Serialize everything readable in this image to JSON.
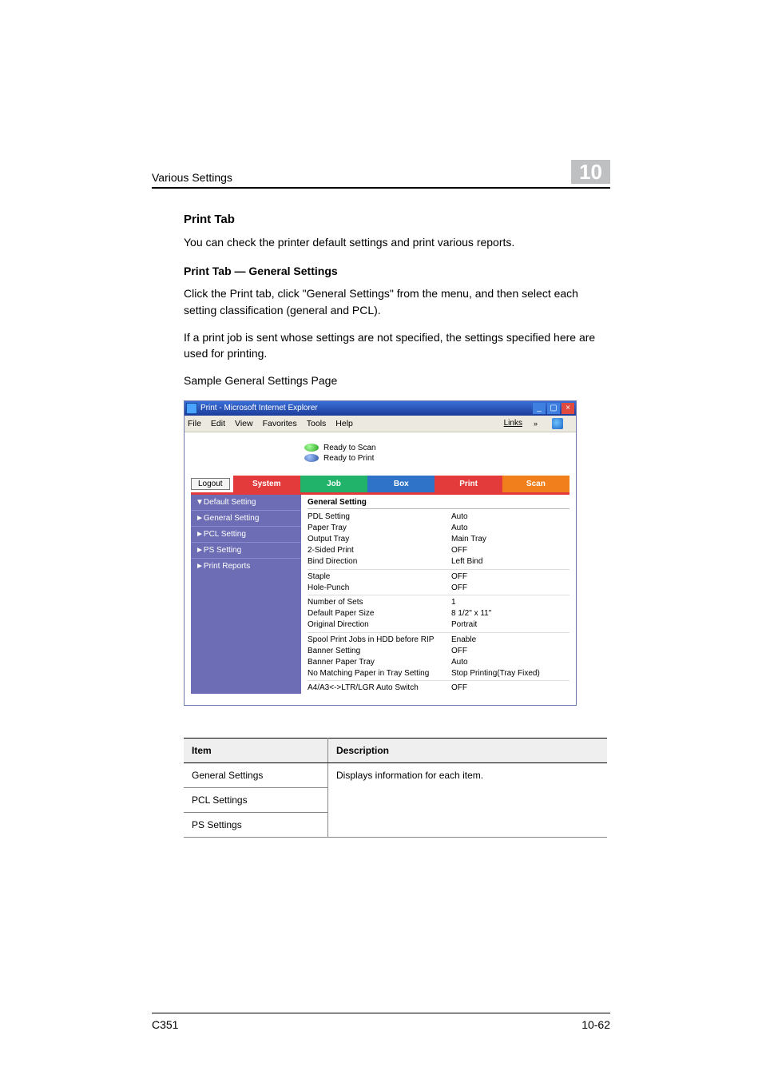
{
  "runhead": {
    "title": "Various Settings",
    "chapter_num": "10"
  },
  "section": {
    "title": "Print Tab",
    "intro": "You can check the printer default settings and print various reports."
  },
  "subsection": {
    "title": "Print Tab — General Settings",
    "p1": "Click the Print tab, click \"General Settings\" from the menu, and then select each setting classification (general and PCL).",
    "p2": "If a print job is sent whose settings are not specified, the settings specified here are used for printing.",
    "caption": "Sample General Settings Page"
  },
  "ie": {
    "title": "Print - Microsoft Internet Explorer",
    "menu": {
      "file": "File",
      "edit": "Edit",
      "view": "View",
      "favorites": "Favorites",
      "tools": "Tools",
      "help": "Help",
      "links": "Links"
    },
    "status": {
      "scan": "Ready to Scan",
      "print": "Ready to Print"
    },
    "logout": "Logout",
    "tabs": {
      "system": "System",
      "job": "Job",
      "box": "Box",
      "print": "Print",
      "scan": "Scan"
    },
    "left_nav": {
      "i0": "▼Default Setting",
      "i1": "►General Setting",
      "i2": "►PCL Setting",
      "i3": "►PS Setting",
      "i4": "►Print Reports"
    },
    "general_heading": "General Setting",
    "rows": {
      "r0": {
        "k": "PDL Setting",
        "v": "Auto"
      },
      "r1": {
        "k": "Paper Tray",
        "v": "Auto"
      },
      "r2": {
        "k": "Output Tray",
        "v": "Main Tray"
      },
      "r3": {
        "k": "2-Sided Print",
        "v": "OFF"
      },
      "r4": {
        "k": "Bind Direction",
        "v": "Left Bind"
      },
      "r5": {
        "k": "Staple",
        "v": "OFF"
      },
      "r6": {
        "k": "Hole-Punch",
        "v": "OFF"
      },
      "r7": {
        "k": "Number of Sets",
        "v": "1"
      },
      "r8": {
        "k": "Default Paper Size",
        "v": "8 1/2\" x 11\""
      },
      "r9": {
        "k": "Original Direction",
        "v": "Portrait"
      },
      "r10": {
        "k": "Spool Print Jobs in HDD before RIP",
        "v": "Enable"
      },
      "r11": {
        "k": "Banner Setting",
        "v": "OFF"
      },
      "r12": {
        "k": "Banner Paper Tray",
        "v": "Auto"
      },
      "r13": {
        "k": "No Matching Paper in Tray Setting",
        "v": "Stop Printing(Tray Fixed)"
      },
      "r14": {
        "k": "A4/A3<->LTR/LGR Auto Switch",
        "v": "OFF"
      }
    }
  },
  "desc_table": {
    "h1": "Item",
    "h2": "Description",
    "r0": {
      "c1": "General Settings",
      "c2": "Displays information for each item."
    },
    "r1": {
      "c1": "PCL Settings"
    },
    "r2": {
      "c1": "PS Settings"
    }
  },
  "footer": {
    "model": "C351",
    "page": "10-62"
  }
}
